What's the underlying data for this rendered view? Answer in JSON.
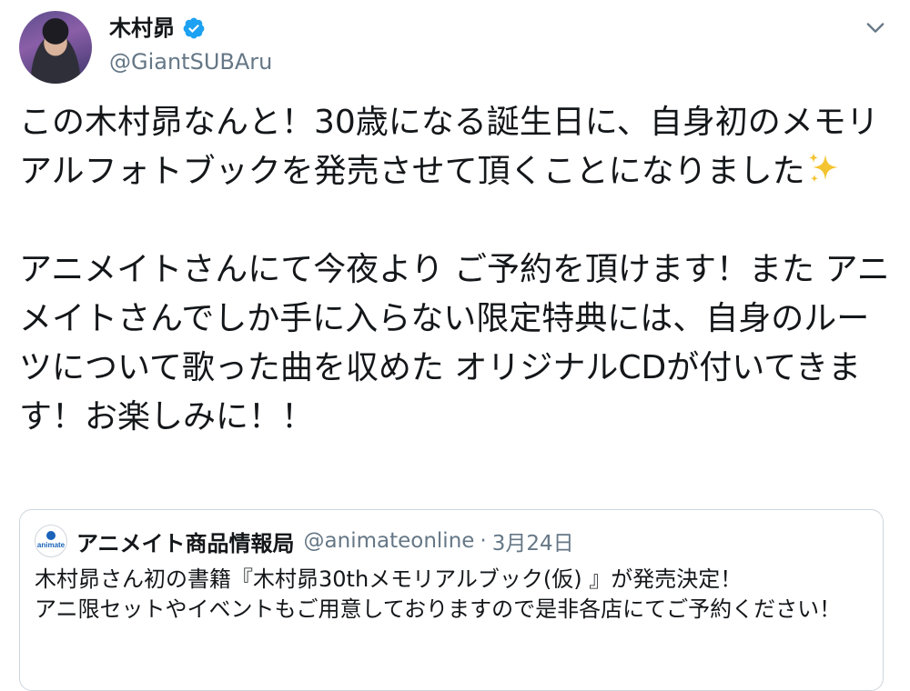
{
  "tweet": {
    "author": {
      "display_name": "木村昴",
      "handle": "@GiantSUBAru",
      "verified": true
    },
    "text_before_emoji": "この木村昴なんと！30歳になる誕生日に、自身初のメモリアルフォトブックを発売させて頂くことになりました",
    "emoji": "sparkles",
    "text_after_emoji": "\n\nアニメイトさんにて今夜より ご予約を頂けます！また アニメイトさんでしか手に入らない限定特典には、自身のルーツについて歌った曲を収めた オリジナルCDが付いてきます！お楽しみに！！"
  },
  "quote": {
    "avatar_label": "animate",
    "display_name": "アニメイト商品情報局",
    "handle": "@animateonline",
    "separator": "·",
    "date": "3月24日",
    "text": "木村昴さん初の書籍『木村昴30thメモリアルブック(仮) 』が発売決定！\nアニ限セットやイベントもご用意しておりますので是非各店にてご予約ください！"
  },
  "colors": {
    "verified_blue": "#1da1f2",
    "secondary_text": "#657786",
    "border": "#ccd6dd",
    "animate_blue": "#1a63b8"
  }
}
